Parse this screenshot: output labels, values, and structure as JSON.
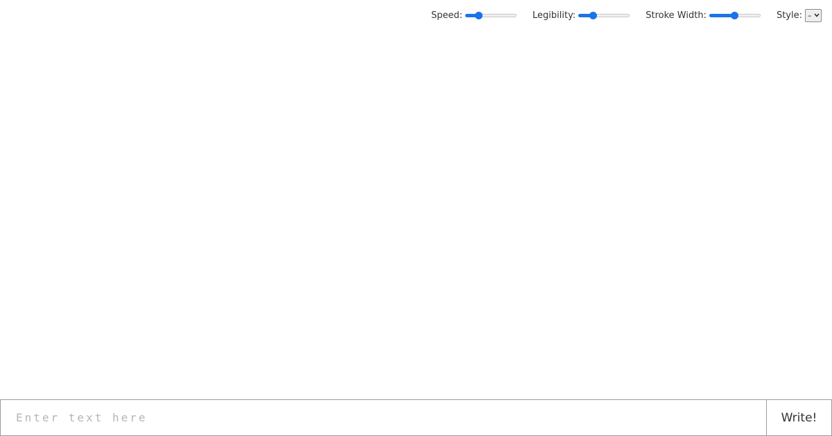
{
  "controls": {
    "speed": {
      "label": "Speed:",
      "value": 0.25
    },
    "legibility": {
      "label": "Legibility:",
      "value": 0.28
    },
    "stroke_width": {
      "label": "Stroke Width:",
      "value": 0.48
    },
    "style": {
      "label": "Style:",
      "selected": "–"
    }
  },
  "input": {
    "placeholder": "Enter text here",
    "value": ""
  },
  "write_button": {
    "label": "Write!"
  },
  "colors": {
    "accent": "#1a73e8"
  }
}
